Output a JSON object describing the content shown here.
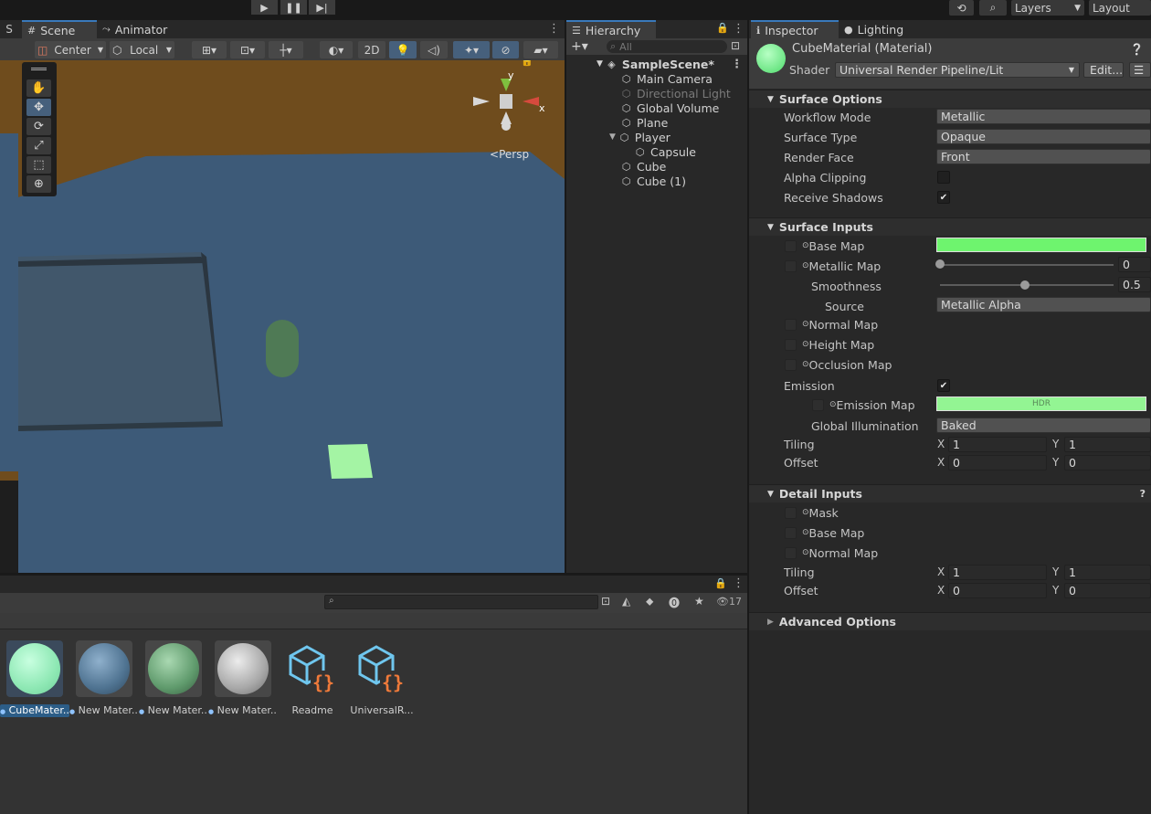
{
  "toolbar": {
    "play_icon": "play-icon",
    "pause_icon": "pause-icon",
    "step_icon": "step-icon",
    "layers_label": "Layers",
    "layout_label": "Layout"
  },
  "scene_tabs": {
    "scene": "Scene",
    "animator": "Animator",
    "left_stub": "S"
  },
  "scene_toolbar": {
    "pivot": "Center",
    "space": "Local",
    "mode_2d": "2D"
  },
  "gizmo": {
    "y": "y",
    "x": "x",
    "persp": "Persp"
  },
  "hierarchy": {
    "tab": "Hierarchy",
    "search_placeholder": "All",
    "scene_name": "SampleScene*",
    "items": [
      {
        "label": "Main Camera"
      },
      {
        "label": "Directional Light"
      },
      {
        "label": "Global Volume"
      },
      {
        "label": "Plane"
      },
      {
        "label": "Player"
      },
      {
        "label": "Capsule"
      },
      {
        "label": "Cube"
      },
      {
        "label": "Cube (1)"
      }
    ]
  },
  "inspector": {
    "tab": "Inspector",
    "lighting_tab": "Lighting",
    "material_name": "CubeMaterial (Material)",
    "shader_label": "Shader",
    "shader_value": "Universal Render Pipeline/Lit",
    "edit_button": "Edit...",
    "surface_options": {
      "header": "Surface Options",
      "workflow_mode_label": "Workflow Mode",
      "workflow_mode_value": "Metallic",
      "surface_type_label": "Surface Type",
      "surface_type_value": "Opaque",
      "render_face_label": "Render Face",
      "render_face_value": "Front",
      "alpha_clipping_label": "Alpha Clipping",
      "alpha_clipping_checked": false,
      "receive_shadows_label": "Receive Shadows",
      "receive_shadows_checked": true
    },
    "surface_inputs": {
      "header": "Surface Inputs",
      "base_map_label": "Base Map",
      "base_map_color": "#6ef46e",
      "metallic_map_label": "Metallic Map",
      "metallic_value": "0",
      "smoothness_label": "Smoothness",
      "smoothness_value": "0.5",
      "source_label": "Source",
      "source_value": "Metallic Alpha",
      "normal_map_label": "Normal Map",
      "height_map_label": "Height Map",
      "occlusion_map_label": "Occlusion Map",
      "emission_label": "Emission",
      "emission_checked": true,
      "emission_map_label": "Emission Map",
      "emission_hdr": "HDR",
      "emission_color": "#93f593",
      "gi_label": "Global Illumination",
      "gi_value": "Baked",
      "tiling_label": "Tiling",
      "tiling_x": "1",
      "tiling_y": "1",
      "offset_label": "Offset",
      "offset_x": "0",
      "offset_y": "0"
    },
    "detail_inputs": {
      "header": "Detail Inputs",
      "mask_label": "Mask",
      "base_map_label": "Base Map",
      "normal_map_label": "Normal Map",
      "tiling_label": "Tiling",
      "tiling_x": "1",
      "tiling_y": "1",
      "offset_label": "Offset",
      "offset_x": "0",
      "offset_y": "0"
    },
    "advanced_options": "Advanced Options",
    "axis_x": "X",
    "axis_y": "Y"
  },
  "project": {
    "hidden_count": "17",
    "assets": [
      {
        "label": "CubeMater...",
        "kind": "material",
        "color": "#8ee8b4",
        "selected": true
      },
      {
        "label": "New Mater...",
        "kind": "material",
        "color": "#4f7391",
        "selected": false
      },
      {
        "label": "New Mater...",
        "kind": "material",
        "color": "#5f9a6c",
        "selected": false
      },
      {
        "label": "New Mater...",
        "kind": "material",
        "color": "#a8a8a8",
        "selected": false
      },
      {
        "label": "Readme",
        "kind": "script",
        "selected": false
      },
      {
        "label": "UniversalR...",
        "kind": "script",
        "selected": false
      }
    ]
  }
}
